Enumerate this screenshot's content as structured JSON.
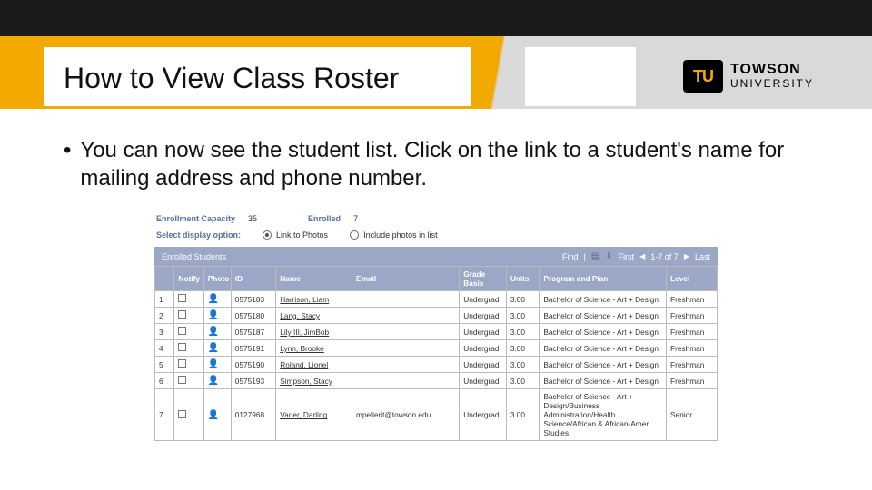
{
  "header": {
    "title": "How to View Class Roster",
    "logo_mark": "TU",
    "logo_line1": "TOWSON",
    "logo_line2": "UNIVERSITY"
  },
  "bullet": {
    "text": "You can now see the student list. Click on the link to a student's name for mailing address and phone number."
  },
  "capacity": {
    "label_cap": "Enrollment Capacity",
    "value_cap": "35",
    "label_enr": "Enrolled",
    "value_enr": "7"
  },
  "display_opt": {
    "label": "Select display option:",
    "opt1": "Link to Photos",
    "opt2": "Include photos in list"
  },
  "bar": {
    "title": "Enrolled Students",
    "find": "Find",
    "first": "First",
    "range": "1-7 of 7",
    "last": "Last"
  },
  "cols": {
    "num": "",
    "notify": "Notify",
    "photo": "Photo",
    "id": "ID",
    "name": "Name",
    "email": "Email",
    "grade": "Grade Basis",
    "units": "Units",
    "program": "Program and Plan",
    "level": "Level"
  },
  "rows": [
    {
      "n": "1",
      "id": "0575183",
      "name": "Harrison, Liam",
      "email": "",
      "grade": "Undergrad",
      "units": "3.00",
      "program": "Bachelor of Science - Art + Design",
      "level": "Freshman"
    },
    {
      "n": "2",
      "id": "0575180",
      "name": "Lang, Stacy",
      "email": "",
      "grade": "Undergrad",
      "units": "3.00",
      "program": "Bachelor of Science - Art + Design",
      "level": "Freshman"
    },
    {
      "n": "3",
      "id": "0575187",
      "name": "Lily III, JimBob",
      "email": "",
      "grade": "Undergrad",
      "units": "3.00",
      "program": "Bachelor of Science - Art + Design",
      "level": "Freshman"
    },
    {
      "n": "4",
      "id": "0575191",
      "name": "Lynn, Brooke",
      "email": "",
      "grade": "Undergrad",
      "units": "3.00",
      "program": "Bachelor of Science - Art + Design",
      "level": "Freshman"
    },
    {
      "n": "5",
      "id": "0575190",
      "name": "Roland, Lionel",
      "email": "",
      "grade": "Undergrad",
      "units": "3.00",
      "program": "Bachelor of Science - Art + Design",
      "level": "Freshman"
    },
    {
      "n": "6",
      "id": "0575193",
      "name": "Simpson, Stacy",
      "email": "",
      "grade": "Undergrad",
      "units": "3.00",
      "program": "Bachelor of Science - Art + Design",
      "level": "Freshman"
    },
    {
      "n": "7",
      "id": "0127968",
      "name": "Vader, Darling",
      "email": "mpellerit@towson.edu",
      "grade": "Undergrad",
      "units": "3.00",
      "program": "Bachelor of Science - Art + Design/Business Administration/Health Science/African & African-Amer Studies",
      "level": "Senior"
    }
  ]
}
